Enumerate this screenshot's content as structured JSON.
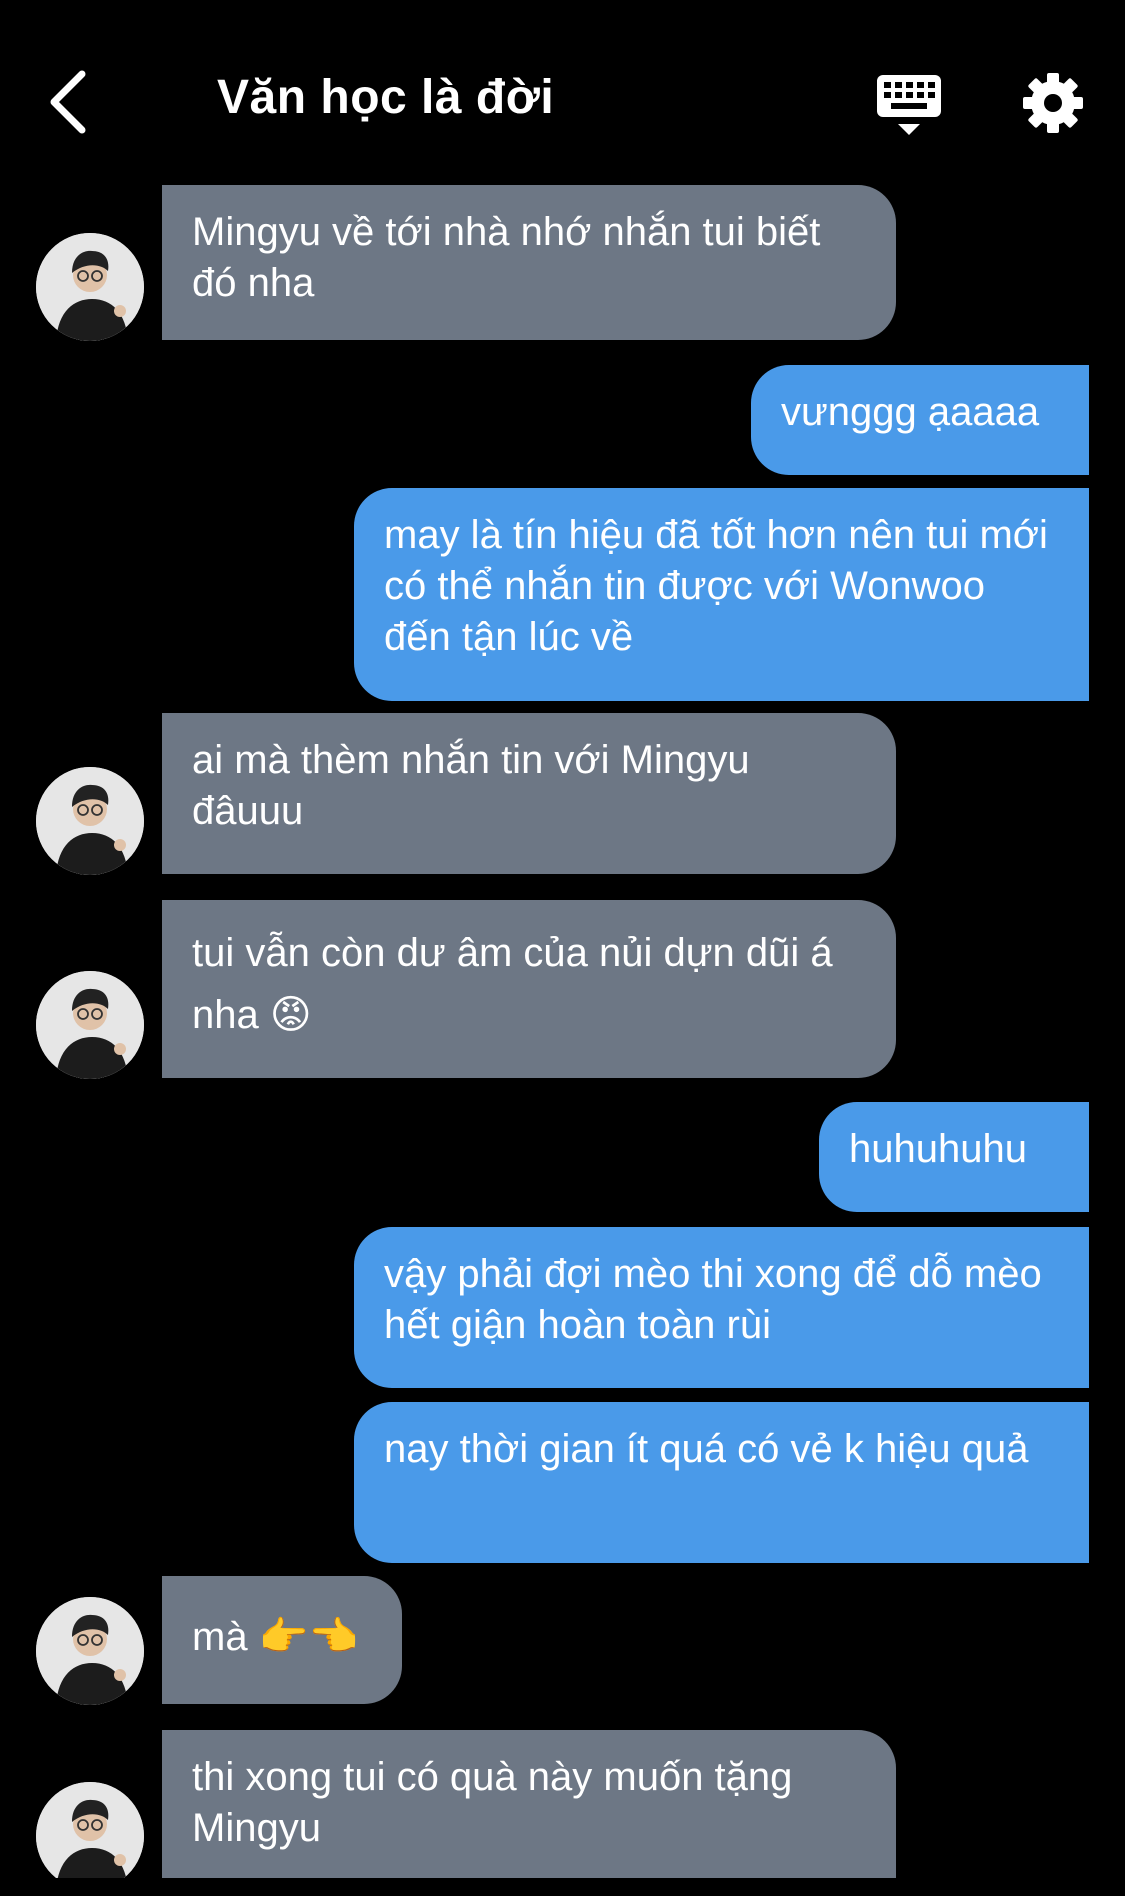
{
  "header": {
    "title": "Văn học là đời"
  },
  "messages": [
    {
      "side": "in",
      "text": "Mingyu về tới nhà nhớ nhắn tui biết đó nha"
    },
    {
      "side": "out",
      "text": "vưnggg ạaaaa"
    },
    {
      "side": "out",
      "text": "may là tín hiệu đã tốt hơn nên tui mới có thể nhắn tin được với Wonwoo đến tận lúc về"
    },
    {
      "side": "in",
      "text": "ai mà thèm nhắn tin với Mingyu đâuuu"
    },
    {
      "side": "in",
      "text": "tui vẫn còn dư âm của nủi dựn dũi á nha 😡"
    },
    {
      "side": "out",
      "text": "huhuhuhu"
    },
    {
      "side": "out",
      "text": "vậy phải đợi mèo thi xong để dỗ mèo hết giận hoàn toàn rùi"
    },
    {
      "side": "out",
      "text": "nay thời gian ít quá có vẻ k hiệu quả"
    },
    {
      "side": "in",
      "text": "mà 👉👈"
    },
    {
      "side": "in",
      "text": "thi xong tui có quà này muốn tặng Mingyu"
    }
  ],
  "colors": {
    "background": "#000000",
    "incoming_bubble": "#6d7785",
    "outgoing_bubble": "#4a9ae9",
    "text": "#ffffff"
  },
  "icons": {
    "back": "chevron-left-icon",
    "keyboard": "keyboard-icon",
    "settings": "gear-icon"
  }
}
